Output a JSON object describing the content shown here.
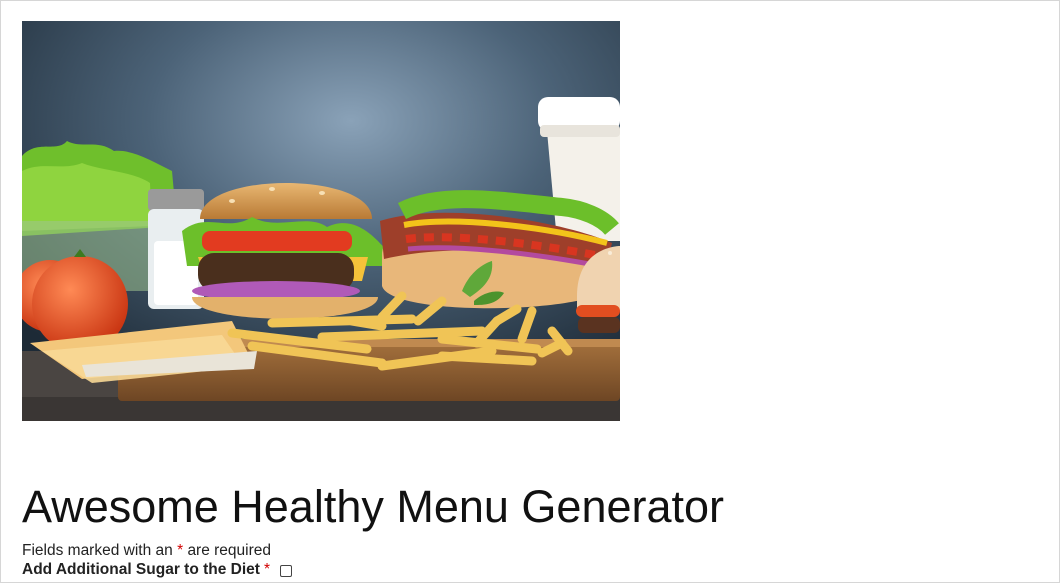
{
  "page": {
    "title": "Awesome Healthy Menu Generator",
    "hero_alt": "Fast food spread: burger, hot dog, fries, cheese slices, tomatoes, lettuce, drink cup"
  },
  "form": {
    "required_note_prefix": "Fields marked with an",
    "required_symbol": "*",
    "required_note_suffix": "are required",
    "fields": [
      {
        "label": "Add Additional Sugar to the Diet",
        "required_symbol": "*",
        "type": "checkbox",
        "checked": false
      }
    ]
  },
  "colors": {
    "required_asterisk": "#d20000",
    "text": "#111111"
  }
}
